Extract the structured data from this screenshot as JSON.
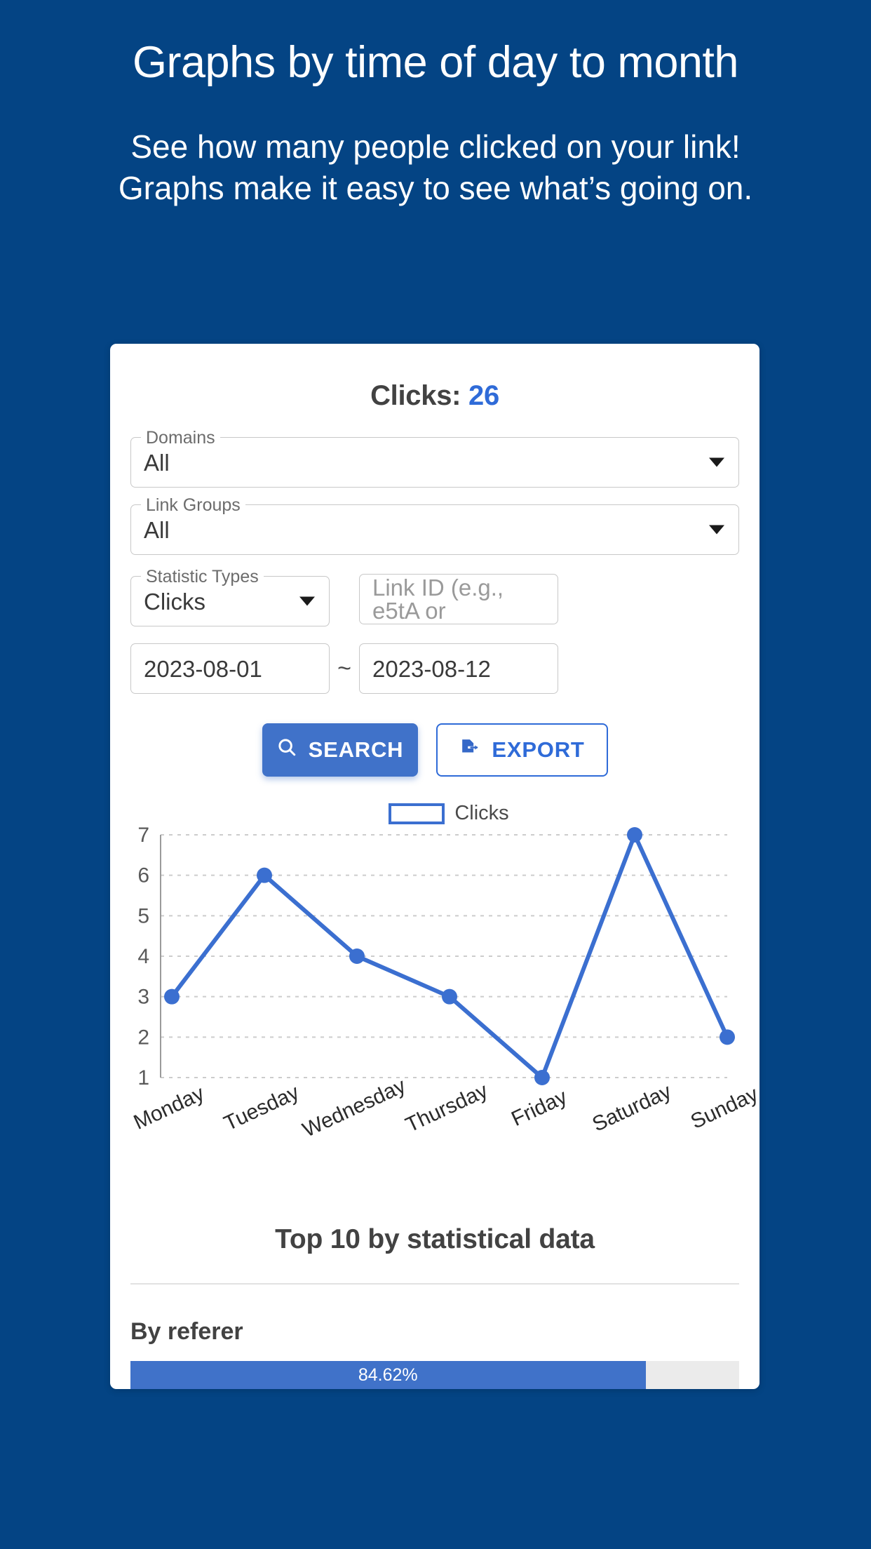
{
  "promo": {
    "title": "Graphs by time of day to month",
    "subtitle": "See how many people clicked on your link!\nGraphs make it easy to see what’s going on."
  },
  "card": {
    "title_label": "Clicks:",
    "clicks_count": "26",
    "fields": {
      "domains": {
        "label": "Domains",
        "value": "All"
      },
      "link_groups": {
        "label": "Link Groups",
        "value": "All"
      },
      "statistic_types": {
        "label": "Statistic Types",
        "value": "Clicks"
      },
      "link_id": {
        "placeholder": "Link ID (e.g., e5tA or",
        "value": ""
      },
      "date_from": {
        "value": "2023-08-01"
      },
      "date_separator": "~",
      "date_to": {
        "value": "2023-08-12"
      }
    },
    "buttons": {
      "search": "SEARCH",
      "export": "EXPORT"
    },
    "top10_heading": "Top 10 by statistical data",
    "by_referer_heading": "By referer",
    "progress": {
      "percent_label": "84.62%",
      "percent": 84.62
    }
  },
  "colors": {
    "background_blue": "#044484",
    "accent_blue": "#4072c9",
    "count_blue": "#2f6bd8",
    "heading_gray": "#424242",
    "line_blue": "#3b6fd0"
  },
  "chart_data": {
    "type": "line",
    "title": "",
    "xlabel": "",
    "ylabel": "",
    "categories": [
      "Monday",
      "Tuesday",
      "Wednesday",
      "Thursday",
      "Friday",
      "Saturday",
      "Sunday"
    ],
    "series": [
      {
        "name": "Clicks",
        "values": [
          3,
          6,
          4,
          3,
          1,
          7,
          2
        ],
        "color": "#3b6fd0"
      }
    ],
    "yticks": [
      1,
      2,
      3,
      4,
      5,
      6,
      7
    ],
    "ylim": [
      1,
      7
    ],
    "grid": true,
    "grid_style": "dotted-horizontal",
    "legend": {
      "position": "top-center",
      "entries": [
        "Clicks"
      ]
    },
    "xtick_rotation_deg": -25,
    "marker": "circle"
  }
}
